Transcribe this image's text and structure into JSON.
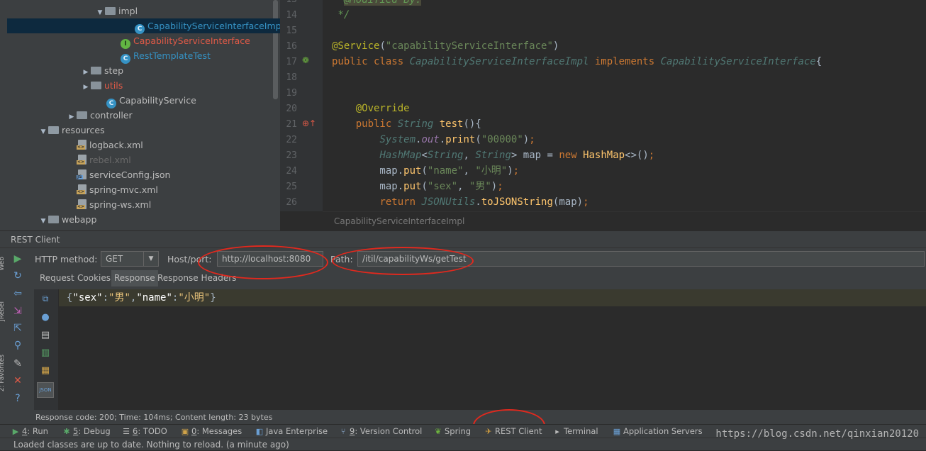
{
  "tree": {
    "items": [
      {
        "label": "impl",
        "kind": "folder",
        "arrow": "▼",
        "color": "#bbbbbb"
      },
      {
        "label": "CapabilityServiceInterfaceImpl",
        "kind": "class",
        "color": "#3592c4",
        "selected": true
      },
      {
        "label": "CapabilityServiceInterface",
        "kind": "interface",
        "color": "#e05a47"
      },
      {
        "label": "RestTemplateTest",
        "kind": "class",
        "color": "#3592c4"
      },
      {
        "label": "step",
        "kind": "folder",
        "arrow": "▶",
        "color": "#bbbbbb"
      },
      {
        "label": "utils",
        "kind": "folder",
        "arrow": "▶",
        "color": "#e05a47"
      },
      {
        "label": "CapabilityService",
        "kind": "class",
        "color": "#bbbbbb"
      },
      {
        "label": "controller",
        "kind": "folder",
        "arrow": "▶",
        "color": "#bbbbbb"
      },
      {
        "label": "resources",
        "kind": "resources",
        "arrow": "▼",
        "color": "#bbbbbb"
      },
      {
        "label": "logback.xml",
        "kind": "xml",
        "color": "#bbbbbb"
      },
      {
        "label": "rebel.xml",
        "kind": "xml",
        "color": "#6a6a6a"
      },
      {
        "label": "serviceConfig.json",
        "kind": "json",
        "color": "#bbbbbb"
      },
      {
        "label": "spring-mvc.xml",
        "kind": "xml",
        "color": "#bbbbbb"
      },
      {
        "label": "spring-ws.xml",
        "kind": "xml",
        "color": "#bbbbbb"
      },
      {
        "label": "webapp",
        "kind": "folder",
        "arrow": "▼",
        "color": "#bbbbbb"
      }
    ]
  },
  "editor": {
    "line_numbers": [
      "13",
      "14",
      "15",
      "16",
      "17",
      "18",
      "19",
      "20",
      "21",
      "22",
      "23",
      "24",
      "25",
      "26"
    ],
    "breadcrumb": "CapabilityServiceInterfaceImpl",
    "partial_top": "@Modified By:"
  },
  "rest_client": {
    "title": "REST Client",
    "http_method_label": "HTTP method:",
    "http_method_value": "GET",
    "host_label": "Host/port:",
    "host_value": "http://localhost:8080",
    "path_label": "Path:",
    "path_value": "/itil/capabilityWs/getTest",
    "tabs": [
      "Request",
      "Cookies",
      "Response",
      "Response Headers"
    ],
    "active_tab": "Response",
    "response_body": "{\"sex\":\"男\",\"name\":\"小明\"}",
    "response_status": "Response code: 200; Time: 104ms; Content length: 23 bytes"
  },
  "side_strip": [
    "Web",
    "JRebel",
    "2: Favorites"
  ],
  "toolwindows": [
    {
      "num": "4",
      "label": ": Run",
      "icon": "run-icon",
      "glyph": "▶",
      "color": "#59a869"
    },
    {
      "num": "5",
      "label": ": Debug",
      "icon": "debug-icon",
      "glyph": "✱",
      "color": "#59a869"
    },
    {
      "num": "6",
      "label": ": TODO",
      "icon": "todo-icon",
      "glyph": "☰",
      "color": "#bbbbbb"
    },
    {
      "num": "0",
      "label": ": Messages",
      "icon": "messages-icon",
      "glyph": "▣",
      "color": "#d0a349"
    },
    {
      "num": "",
      "label": "Java Enterprise",
      "icon": "java-enterprise-icon",
      "glyph": "◧",
      "color": "#6a9fd4"
    },
    {
      "num": "9",
      "label": ": Version Control",
      "icon": "version-control-icon",
      "glyph": "⑂",
      "color": "#8fb0d8"
    },
    {
      "num": "",
      "label": "Spring",
      "icon": "spring-icon",
      "glyph": "❦",
      "color": "#6db33f"
    },
    {
      "num": "",
      "label": "REST Client",
      "icon": "rest-client-icon",
      "glyph": "✈",
      "color": "#d9a441"
    },
    {
      "num": "",
      "label": "Terminal",
      "icon": "terminal-icon",
      "glyph": "▸",
      "color": "#bbbbbb"
    },
    {
      "num": "",
      "label": "Application Servers",
      "icon": "app-servers-icon",
      "glyph": "▦",
      "color": "#6a9fd4"
    }
  ],
  "status_bar": "Loaded classes are up to date. Nothing to reload. (a minute ago)",
  "watermark": "https://blog.csdn.net/qinxian20120",
  "colors": {
    "highlight_ring": "#e0291e",
    "keyword": "#cc7832",
    "annotation": "#bbb529",
    "string": "#6a8759"
  }
}
